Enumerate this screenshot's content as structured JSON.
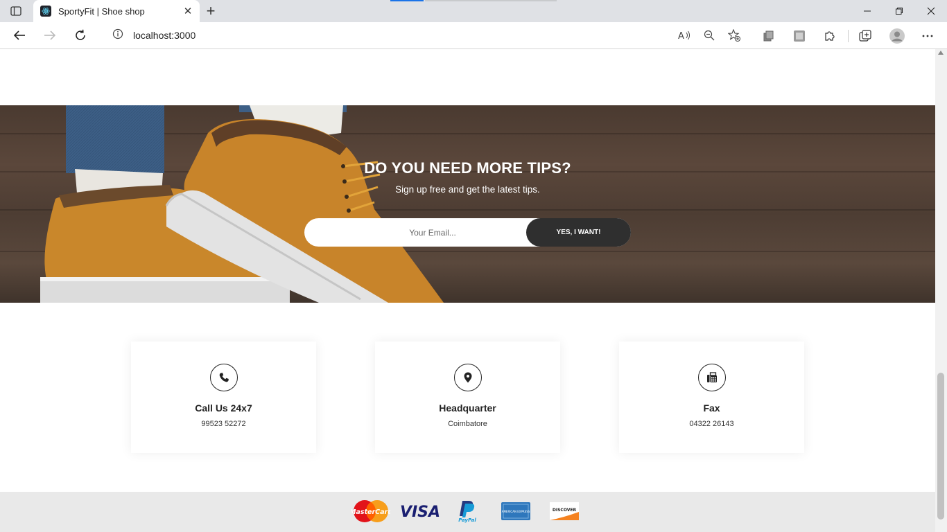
{
  "browser": {
    "tab_title": "SportyFit | Shoe shop",
    "url": "localhost:3000"
  },
  "newsletter": {
    "title": "DO YOU NEED MORE TIPS?",
    "subtitle": "Sign up free and get the latest tips.",
    "email_placeholder": "Your Email...",
    "button_label": "YES, I WANT!"
  },
  "contact_cards": [
    {
      "icon": "phone-icon",
      "title": "Call Us 24x7",
      "value": "99523 52272"
    },
    {
      "icon": "location-pin-icon",
      "title": "Headquarter",
      "value": "Coimbatore"
    },
    {
      "icon": "fax-icon",
      "title": "Fax",
      "value": "04322 26143"
    }
  ],
  "payment_methods": {
    "mastercard": "MasterCard",
    "visa": "VISA",
    "paypal": "PayPal",
    "amex": "AMERICAN EXPRESS",
    "discover": "DISCOVER"
  },
  "colors": {
    "dark_button": "#2f2f2f",
    "footer_bg": "#e9e9e9"
  }
}
